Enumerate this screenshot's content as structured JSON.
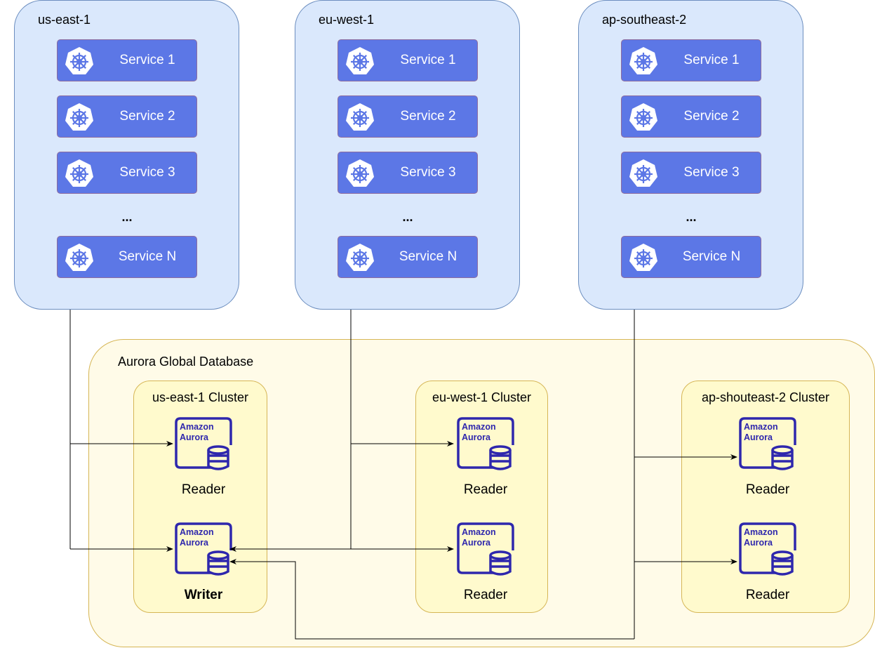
{
  "colors": {
    "region_fill": "#dae8fc",
    "region_stroke": "#6c8ebf",
    "service_fill": "#5c77e6",
    "global_fill": "#fffbe8",
    "cluster_fill": "#fffacd",
    "cluster_stroke": "#d6b656",
    "aurora_icon": "#2e27ad"
  },
  "regions": [
    {
      "name": "us-east-1",
      "services": [
        "Service 1",
        "Service 2",
        "Service 3",
        "Service N"
      ],
      "ellipsis": "..."
    },
    {
      "name": "eu-west-1",
      "services": [
        "Service 1",
        "Service 2",
        "Service 3",
        "Service N"
      ],
      "ellipsis": "..."
    },
    {
      "name": "ap-southeast-2",
      "services": [
        "Service 1",
        "Service 2",
        "Service 3",
        "Service N"
      ],
      "ellipsis": "..."
    }
  ],
  "service_icon": "kubernetes-helm-icon",
  "global": {
    "title": "Aurora Global Database",
    "clusters": [
      {
        "title": "us-east-1 Cluster",
        "instances": [
          {
            "role": "Reader"
          },
          {
            "role": "Writer"
          }
        ]
      },
      {
        "title": "eu-west-1 Cluster",
        "instances": [
          {
            "role": "Reader"
          },
          {
            "role": "Reader"
          }
        ]
      },
      {
        "title": "ap-shouteast-2 Cluster",
        "instances": [
          {
            "role": "Reader"
          },
          {
            "role": "Reader"
          }
        ]
      }
    ],
    "icon_text_1": "Amazon",
    "icon_text_2": "Aurora"
  }
}
